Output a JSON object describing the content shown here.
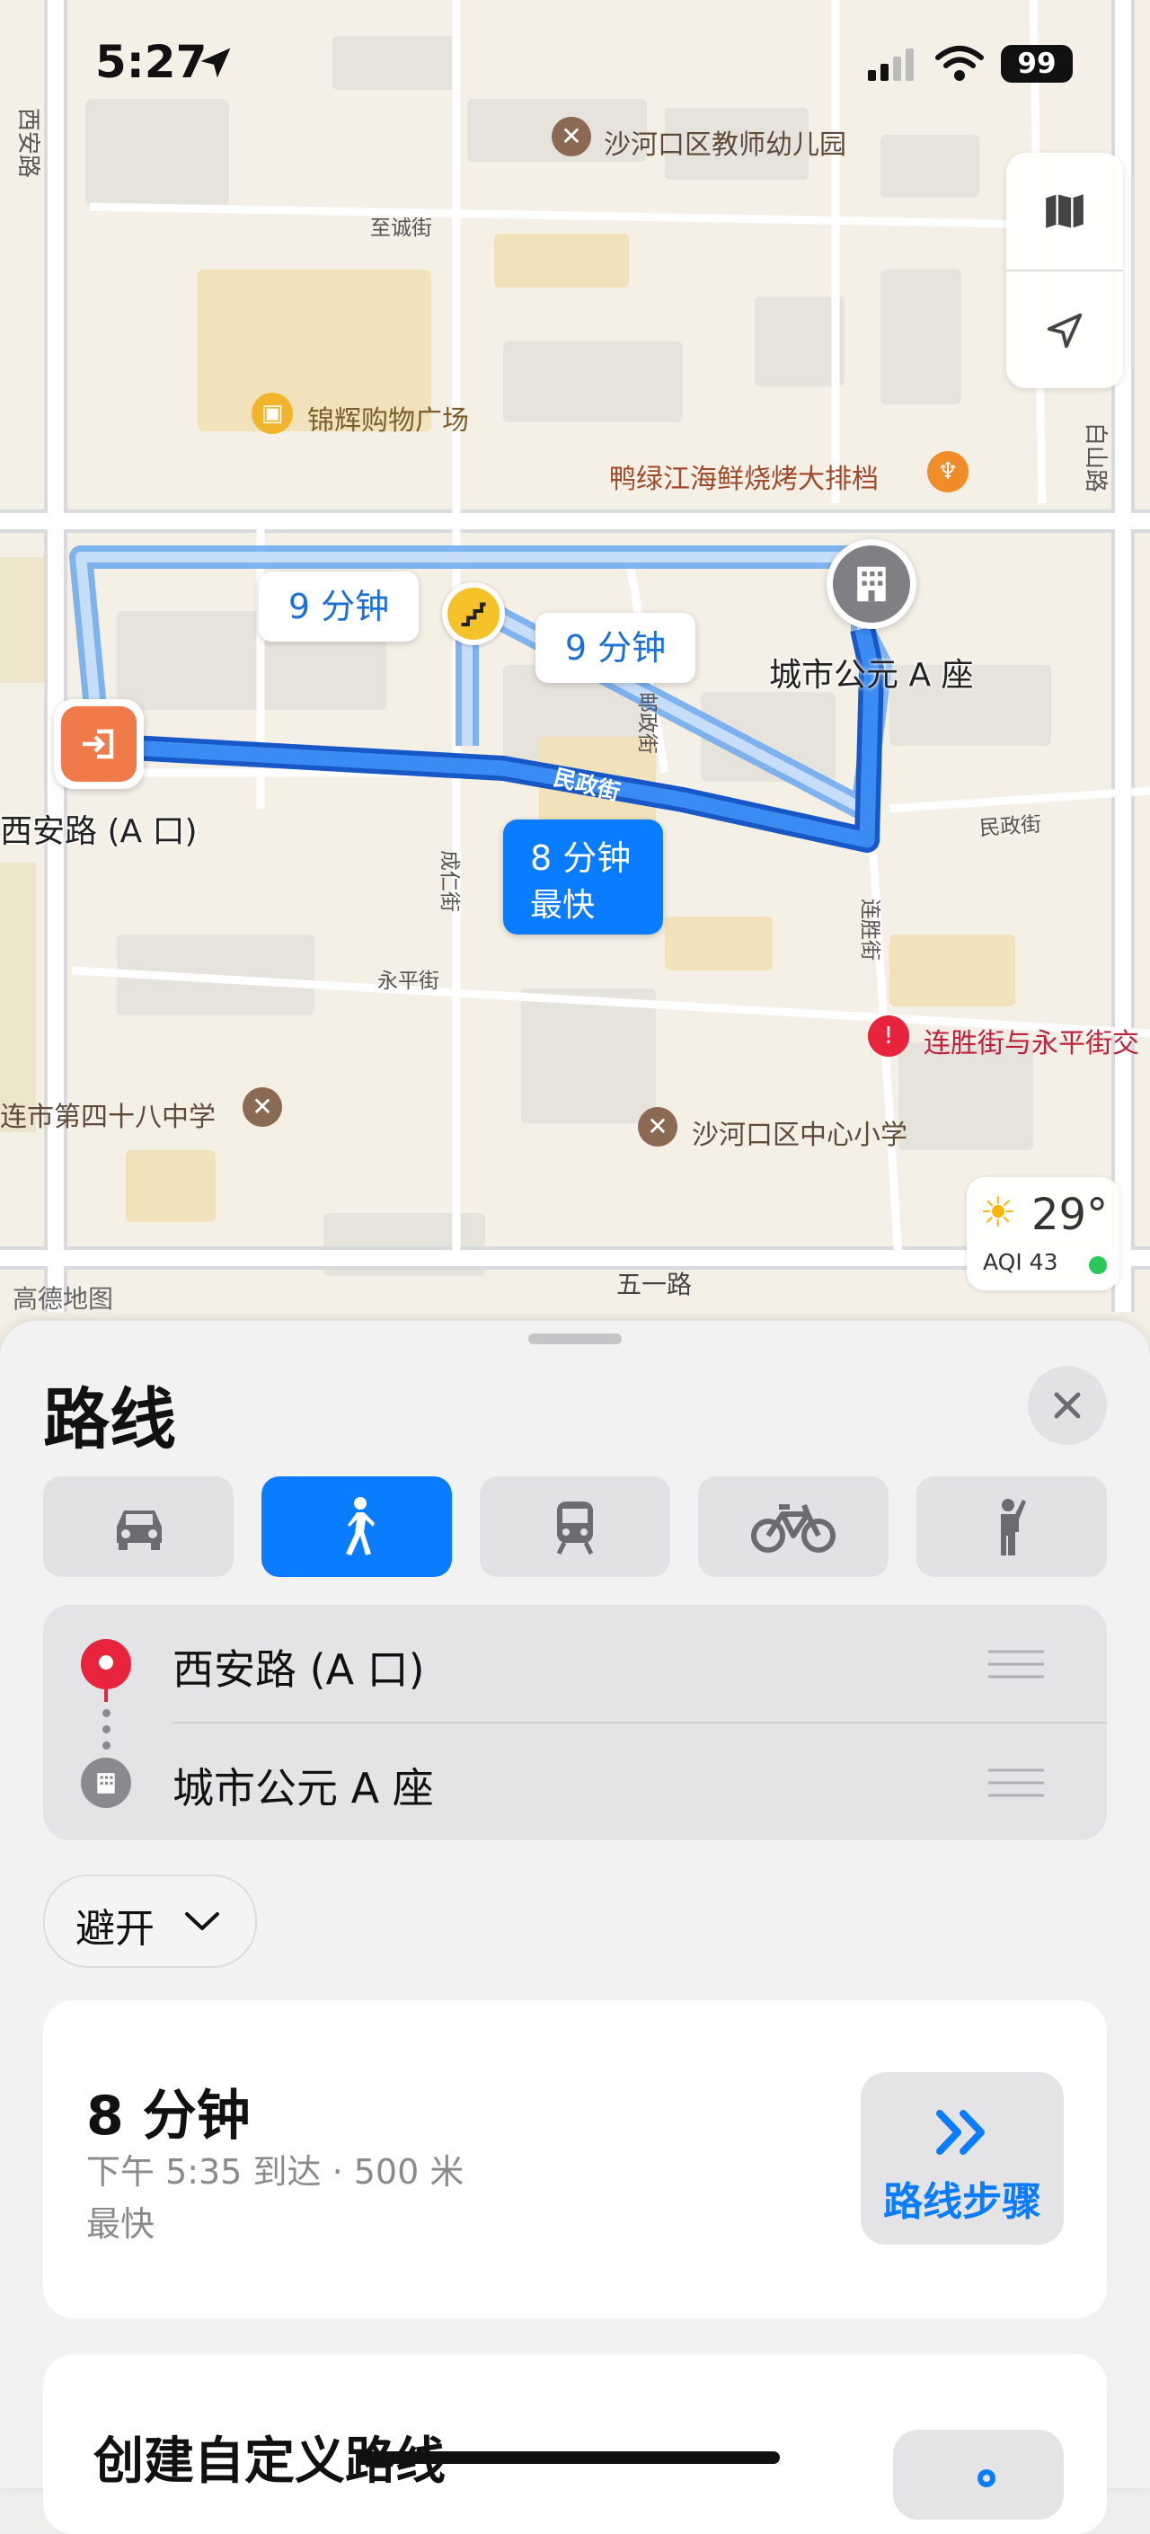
{
  "status_bar": {
    "time": "5:27",
    "battery": "99",
    "icons": [
      "location-arrow-icon",
      "signal-icon",
      "wifi-icon",
      "battery-icon"
    ]
  },
  "map": {
    "pois": {
      "kindergarten": "沙河口区教师幼儿园",
      "mall": "锦辉购物广场",
      "bbq": "鸭绿江海鲜烧烤大排档",
      "intersection": "连胜街与永平街交",
      "middle_school": "连市第四十八中学",
      "primary_school": "沙河口区中心小学"
    },
    "streets": {
      "xian_road": "西安路",
      "zhicheng": "至诚街",
      "baishan": "白山路",
      "youzheng": "邮政街",
      "chengren": "成仁街",
      "minzheng_main": "民政街",
      "minzheng_side": "民政街",
      "liansheng": "连胜街",
      "yongping": "永平街",
      "wuyi": "五一路"
    },
    "origin_label": "西安路 (A 口)",
    "destination_label": "城市公元 A 座",
    "route_bubbles": {
      "alt1": "9 分钟",
      "alt2": "9 分钟",
      "main_time": "8 分钟",
      "main_tag": "最快"
    },
    "weather": {
      "temp": "29°",
      "aqi": "AQI 43"
    },
    "attribution": "高德地图"
  },
  "sheet": {
    "title": "路线",
    "modes": [
      {
        "name": "drive",
        "icon": "car-icon",
        "active": false
      },
      {
        "name": "walk",
        "icon": "walk-icon",
        "active": true
      },
      {
        "name": "transit",
        "icon": "train-icon",
        "active": false
      },
      {
        "name": "cycle",
        "icon": "bike-icon",
        "active": false
      },
      {
        "name": "rideshare",
        "icon": "hail-icon",
        "active": false
      }
    ],
    "from": "西安路 (A 口)",
    "to": "城市公元 A 座",
    "avoid_label": "避开",
    "route": {
      "duration": "8 分钟",
      "detail": "下午 5:35 到达 · 500 米",
      "tag": "最快",
      "steps_label": "路线步骤"
    },
    "custom_route_label": "创建自定义路线"
  },
  "colors": {
    "accent": "#0a7cff",
    "route": "#2f7fe6",
    "origin": "#f07a4a",
    "pin_red": "#e8243c"
  }
}
